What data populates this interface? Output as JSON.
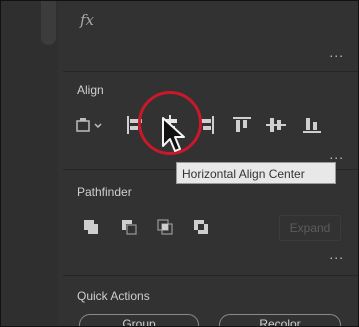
{
  "header": {
    "fx_label": "fx",
    "more_label": "..."
  },
  "align": {
    "title": "Align",
    "tooltip": "Horizontal Align Center",
    "icons": [
      "align-to-selection-icon",
      "horizontal-align-left-icon",
      "horizontal-align-center-icon",
      "horizontal-align-right-icon",
      "vertical-align-top-icon",
      "vertical-align-center-icon",
      "vertical-align-bottom-icon"
    ],
    "more_label": "..."
  },
  "pathfinder": {
    "title": "Pathfinder",
    "icons": [
      "unite-icon",
      "minus-front-icon",
      "intersect-icon",
      "exclude-icon"
    ],
    "expand_label": "Expand",
    "more_label": "..."
  },
  "quick_actions": {
    "title": "Quick Actions",
    "buttons": [
      "Group",
      "Recolor"
    ]
  },
  "colors": {
    "panel_bg": "#323232",
    "text": "#d6d6d6",
    "highlight": "#c8182a",
    "tooltip_bg": "#e8e8e8"
  }
}
